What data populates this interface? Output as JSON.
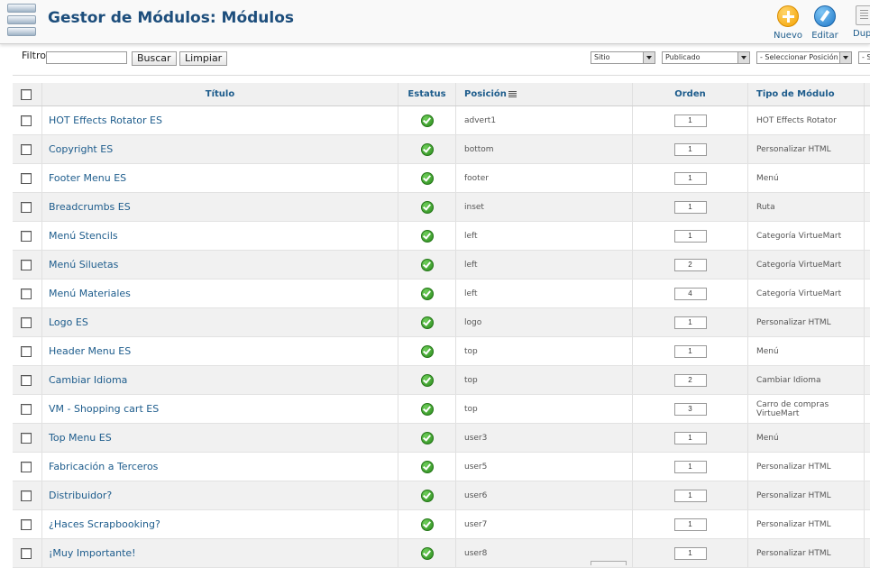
{
  "header": {
    "title": "Gestor de Módulos: Módulos",
    "toolbar": [
      {
        "label": "Nuevo",
        "icon": "new-icon"
      },
      {
        "label": "Editar",
        "icon": "edit-icon"
      },
      {
        "label": "Dupli",
        "icon": "copy-icon"
      }
    ]
  },
  "filter": {
    "label": "Filtro:",
    "value": "",
    "search_button": "Buscar",
    "clear_button": "Limpiar",
    "site_select": "Sitio",
    "state_select": "Publicado",
    "position_select": "- Seleccionar Posición -",
    "extra_select": "- S"
  },
  "table": {
    "columns": {
      "title": "Título",
      "status": "Estatus",
      "position": "Posición",
      "order": "Orden",
      "type": "Tipo de Módulo"
    },
    "rows": [
      {
        "title": "HOT Effects Rotator ES",
        "position": "advert1",
        "order": "1",
        "type": "HOT Effects Rotator"
      },
      {
        "title": "Copyright ES",
        "position": "bottom",
        "order": "1",
        "type": "Personalizar HTML"
      },
      {
        "title": "Footer Menu ES",
        "position": "footer",
        "order": "1",
        "type": "Menú"
      },
      {
        "title": "Breadcrumbs ES",
        "position": "inset",
        "order": "1",
        "type": "Ruta"
      },
      {
        "title": "Menú Stencils",
        "position": "left",
        "order": "1",
        "type": "Categoría VirtueMart"
      },
      {
        "title": "Menú Siluetas",
        "position": "left",
        "order": "2",
        "type": "Categoría VirtueMart"
      },
      {
        "title": "Menú Materiales",
        "position": "left",
        "order": "4",
        "type": "Categoría VirtueMart"
      },
      {
        "title": "Logo ES",
        "position": "logo",
        "order": "1",
        "type": "Personalizar HTML"
      },
      {
        "title": "Header Menu ES",
        "position": "top",
        "order": "1",
        "type": "Menú"
      },
      {
        "title": "Cambiar Idioma",
        "position": "top",
        "order": "2",
        "type": "Cambiar Idioma"
      },
      {
        "title": "VM - Shopping cart ES",
        "position": "top",
        "order": "3",
        "type": "Carro de compras VirtueMart"
      },
      {
        "title": "Top Menu ES",
        "position": "user3",
        "order": "1",
        "type": "Menú"
      },
      {
        "title": "Fabricación a Terceros",
        "position": "user5",
        "order": "1",
        "type": "Personalizar HTML"
      },
      {
        "title": "Distribuidor?",
        "position": "user6",
        "order": "1",
        "type": "Personalizar HTML"
      },
      {
        "title": "¿Haces Scrapbooking?",
        "position": "user7",
        "order": "1",
        "type": "Personalizar HTML"
      },
      {
        "title": "¡Muy Importante!",
        "position": "user8",
        "order": "1",
        "type": "Personalizar HTML"
      }
    ]
  },
  "colors": {
    "title": "#1d4e7c",
    "link": "#1d5c8c",
    "published": "#2a8a1c",
    "row_alt": "#f1f1f1"
  }
}
